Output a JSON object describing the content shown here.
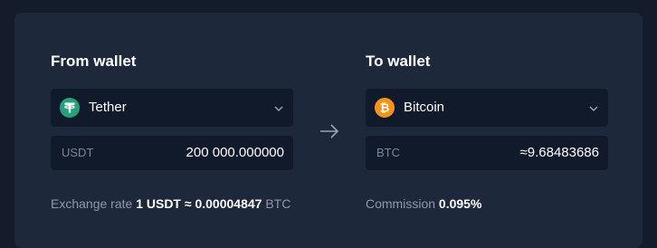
{
  "from_wallet": {
    "heading": "From wallet",
    "coin": {
      "name": "Tether",
      "icon": "tether-icon",
      "color": "#26a17b"
    },
    "amount": {
      "unit": "USDT",
      "value": "200 000.000000"
    },
    "rate": {
      "label": "Exchange rate",
      "base_amount": "1",
      "base_unit": "USDT",
      "approx": "≈",
      "quote_amount": "0.00004847",
      "quote_unit": "BTC"
    }
  },
  "to_wallet": {
    "heading": "To wallet",
    "coin": {
      "name": "Bitcoin",
      "icon": "bitcoin-icon",
      "color": "#f7931a"
    },
    "amount": {
      "unit": "BTC",
      "value": "≈9.68483686"
    },
    "commission": {
      "label": "Commission",
      "value": "0.095%"
    }
  },
  "icons": {
    "arrow": "arrow-right-icon",
    "chevron": "chevron-down-icon"
  }
}
